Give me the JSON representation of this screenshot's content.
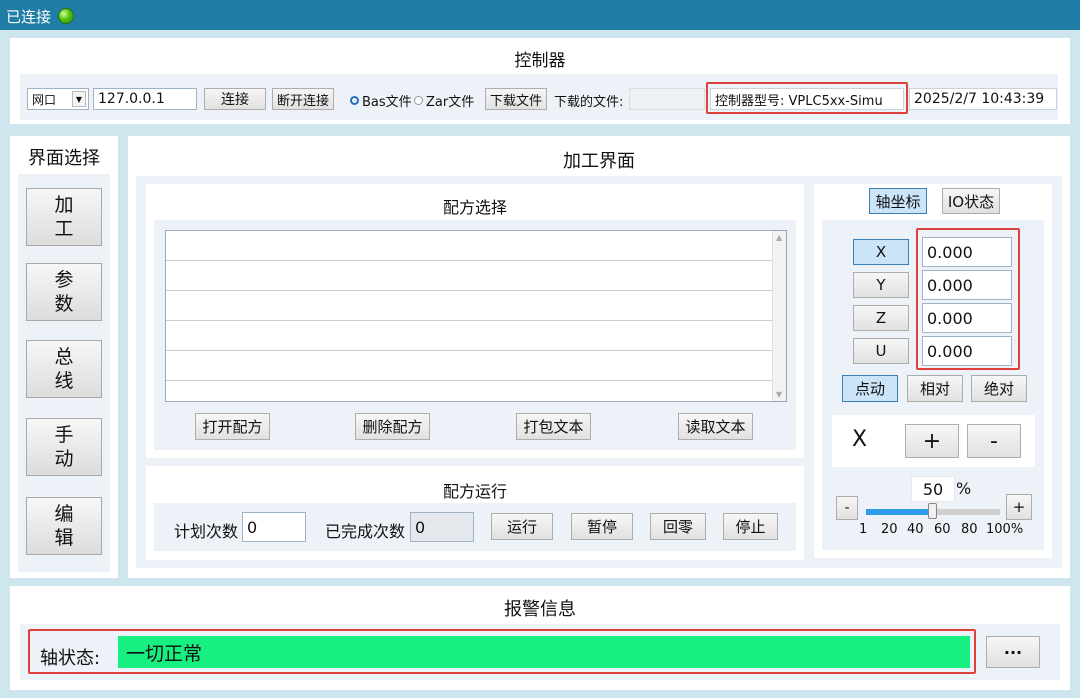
{
  "titlebar": {
    "status_text": "已连接",
    "led_color": "#4fc40f"
  },
  "controller": {
    "header": "控制器",
    "port_select": "网口",
    "ip": "127.0.0.1",
    "connect": "连接",
    "disconnect": "断开连接",
    "radio_bas": "Bas文件",
    "radio_zar": "Zar文件",
    "download_btn": "下载文件",
    "downloaded_label": "下载的文件:",
    "downloaded_value": "",
    "model": "控制器型号: VPLC5xx-Simu",
    "datetime": "2025/2/7 10:43:39"
  },
  "nav": {
    "header": "界面选择",
    "items": [
      {
        "line1": "加",
        "line2": "工"
      },
      {
        "line1": "参",
        "line2": "数"
      },
      {
        "line1": "总",
        "line2": "线"
      },
      {
        "line1": "手",
        "line2": "动"
      },
      {
        "line1": "编",
        "line2": "辑"
      }
    ]
  },
  "process": {
    "header": "加工界面",
    "recipe_select": {
      "header": "配方选择",
      "buttons": [
        "打开配方",
        "删除配方",
        "打包文本",
        "读取文本"
      ]
    },
    "recipe_run": {
      "header": "配方运行",
      "plan_label": "计划次数",
      "plan_value": "0",
      "done_label": "已完成次数",
      "done_value": "0",
      "buttons": [
        "运行",
        "暂停",
        "回零",
        "停止"
      ]
    }
  },
  "axis_panel": {
    "tabs": [
      "轴坐标",
      "IO状态"
    ],
    "axes": [
      {
        "name": "X",
        "value": "0.000"
      },
      {
        "name": "Y",
        "value": "0.000"
      },
      {
        "name": "Z",
        "value": "0.000"
      },
      {
        "name": "U",
        "value": "0.000"
      }
    ],
    "modes": [
      "点动",
      "相对",
      "绝对"
    ],
    "jog_axis": "X",
    "plus": "+",
    "minus": "-",
    "speed_value": "50",
    "speed_unit": "%",
    "slider_percent": 50,
    "slider_ticks": [
      "1",
      "20",
      "40",
      "60",
      "80",
      "100%"
    ]
  },
  "alarm": {
    "header": "报警信息",
    "axis_status_label": "轴状态:",
    "axis_status_value": "一切正常",
    "more_button": "···",
    "status_color": "#17f080"
  }
}
